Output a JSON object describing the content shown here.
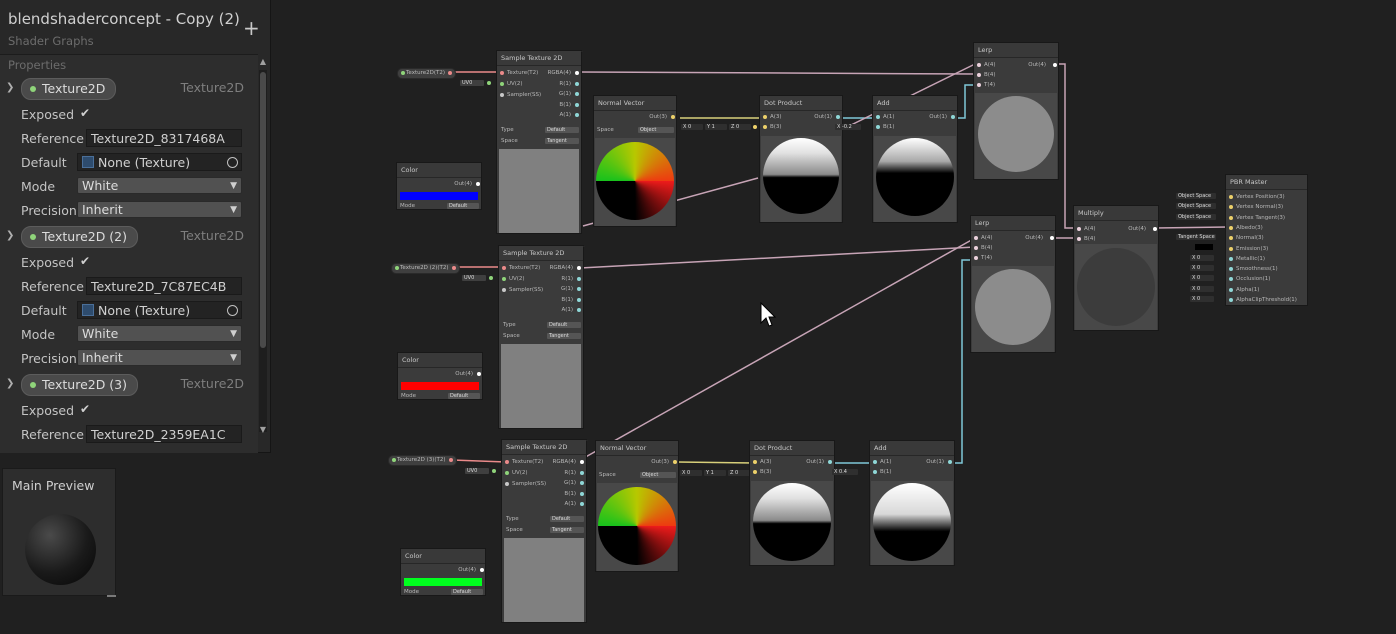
{
  "blackboard": {
    "title": "blendshaderconcept - Copy (2)",
    "subtitle": "Shader Graphs",
    "add_symbol": "+",
    "section_label": "Properties",
    "properties": [
      {
        "name": "Texture2D",
        "type": "Texture2D",
        "exposed": true,
        "reference": "Texture2D_8317468A",
        "default": "None (Texture)",
        "mode": "White",
        "precision": "Inherit"
      },
      {
        "name": "Texture2D (2)",
        "type": "Texture2D",
        "exposed": true,
        "reference": "Texture2D_7C87EC4B",
        "default": "None (Texture)",
        "mode": "White",
        "precision": "Inherit"
      },
      {
        "name": "Texture2D (3)",
        "type": "Texture2D",
        "exposed": true,
        "reference": "Texture2D_2359EA1C"
      }
    ],
    "labels": {
      "exposed": "Exposed",
      "reference": "Reference",
      "default": "Default",
      "mode": "Mode",
      "precision": "Precision"
    }
  },
  "main_preview": {
    "title": "Main Preview"
  },
  "nodes": {
    "sample_title": "Sample Texture 2D",
    "sample_inputs": [
      "Texture(T2)",
      "UV(2)",
      "Sampler(SS)"
    ],
    "sample_outputs": [
      "RGBA(4)",
      "R(1)",
      "G(1)",
      "B(1)",
      "A(1)"
    ],
    "sample_type_label": "Type",
    "sample_type_value": "Default",
    "sample_space_label": "Space",
    "sample_space_value": "Tangent",
    "uv_value": "UV0",
    "normal_title": "Normal Vector",
    "normal_out": "Out(3)",
    "normal_space_label": "Space",
    "normal_space_value": "Object",
    "dot_title": "Dot Product",
    "dot_inputs": [
      "A(3)",
      "B(3)"
    ],
    "dot_out": "Out(1)",
    "vec_x_label": "X",
    "vec_y_label": "Y",
    "vec_z_label": "Z",
    "vec_x": "0",
    "vec_y": "1",
    "vec_z": "0",
    "add_title": "Add",
    "add_inputs": [
      "A(1)",
      "B(1)"
    ],
    "add_out": "Out(1)",
    "add_b_top": "-0.2",
    "add_b_bottom": "0.4",
    "color_title": "Color",
    "color_out": "Out(4)",
    "color_mode_label": "Mode",
    "color_mode_value": "Default",
    "colors": {
      "blue": "#0000ff",
      "red": "#ff0000",
      "green": "#00ff1e"
    },
    "lerp_title": "Lerp",
    "lerp_inputs": [
      "A(4)",
      "B(4)",
      "T(4)"
    ],
    "lerp_out": "Out(4)",
    "multiply_title": "Multiply",
    "multiply_inputs": [
      "A(4)",
      "B(4)"
    ],
    "multiply_out": "Out(4)",
    "property_nodes": [
      "Texture2D(T2)",
      "Texture2D (2)(T2)",
      "Texture2D (3)(T2)"
    ],
    "pbr_title": "PBR Master",
    "pbr_ports": [
      "Vertex Position(3)",
      "Vertex Normal(3)",
      "Vertex Tangent(3)",
      "Albedo(3)",
      "Normal(3)",
      "Emission(3)",
      "Metallic(1)",
      "Smoothness(1)",
      "Occlusion(1)",
      "Alpha(1)",
      "AlphaClipThreshold(1)"
    ],
    "pbr_left": [
      "Object Space",
      "Object Space",
      "Object Space",
      "",
      "Tangent Space",
      "",
      "X  0",
      "X  0",
      "X  0",
      "X  0",
      "X  0"
    ]
  }
}
